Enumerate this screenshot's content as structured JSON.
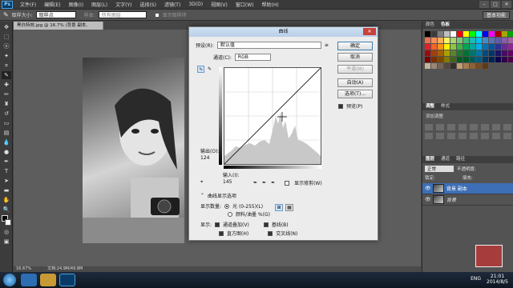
{
  "app": {
    "logo": "Ps"
  },
  "menu": [
    "文件(F)",
    "编辑(E)",
    "图像(I)",
    "图层(L)",
    "文字(Y)",
    "选择(S)",
    "滤镜(T)",
    "3D(D)",
    "视图(V)",
    "窗口(W)",
    "帮助(H)"
  ],
  "window_controls": [
    "–",
    "□",
    "✕"
  ],
  "options": {
    "brush_size_label": "取样大小:",
    "brush_size_value": "取样点",
    "sample_label": "样本:",
    "sample_value": "所有图层",
    "show_ring_label": "显示取样环",
    "workspace": "基本功能"
  },
  "document": {
    "tab_title": "黑白特效.jpg @ 16.7% (背景 副本, RGB/8#) *",
    "zoom": "16.67%",
    "doc_size": "文档:24.9M/49.8M"
  },
  "tools": [
    "move",
    "marquee",
    "lasso",
    "quick-select",
    "crop",
    "eyedropper",
    "heal",
    "brush",
    "stamp",
    "history",
    "eraser",
    "gradient",
    "blur",
    "dodge",
    "pen",
    "type",
    "path-select",
    "shape",
    "hand",
    "zoom",
    "fg-bg",
    "mask",
    "screen"
  ],
  "dialog": {
    "title": "曲线",
    "close": "✕",
    "preset_label": "预设(R):",
    "preset_value": "默认值",
    "channel_label": "通道(C):",
    "channel_value": "RGB",
    "output_label": "输出(O):",
    "output_value": "124",
    "input_label": "输入(I):",
    "input_value": "145",
    "show_clipping": "显示修剪(W)",
    "curve_display_options": "曲线显示选项",
    "show_amount_label": "显示数量:",
    "light_option": "光 (0-255)(L)",
    "pigment_option": "颜料/油墨 %(G)",
    "show_label": "显示:",
    "channel_overlay": "通道叠加(V)",
    "baseline": "基线(B)",
    "histogram": "直方图(H)",
    "intersection_line": "交叉线(N)",
    "buttons": {
      "ok": "确定",
      "cancel": "取消",
      "smooth": "平滑(M)",
      "auto": "自动(A)",
      "options": "选项(T)...",
      "preview": "预览(P)"
    }
  },
  "panels": {
    "color_tabs": [
      "颜色",
      "色板"
    ],
    "adjust_tabs": [
      "调整",
      "样式"
    ],
    "adjust_add": "添加调整",
    "layer_tabs": [
      "图层",
      "通道",
      "路径"
    ],
    "blend_mode": "正常",
    "opacity": "不透明度:",
    "lock": "锁定:",
    "fill": "填充:",
    "layers": [
      {
        "name": "背景 副本",
        "selected": true
      },
      {
        "name": "背景",
        "selected": false
      }
    ]
  },
  "swatches": [
    "#000000",
    "#3b3b3b",
    "#7d7d7d",
    "#bfbfbf",
    "#ffffff",
    "#ff0000",
    "#ffff00",
    "#00ff00",
    "#00ffff",
    "#0000ff",
    "#ff00ff",
    "#a50000",
    "#a5a500",
    "#00a500",
    "#f26c4f",
    "#f68e55",
    "#fbaf5c",
    "#fff467",
    "#acd372",
    "#7cc576",
    "#3bb878",
    "#1abbb4",
    "#00bff3",
    "#438ccb",
    "#5574b9",
    "#605ca8",
    "#855fa8",
    "#a763a8",
    "#ed1c24",
    "#f26522",
    "#f7941d",
    "#fff200",
    "#8dc73f",
    "#39b54a",
    "#00a651",
    "#00a99d",
    "#00aeef",
    "#0072bc",
    "#0054a6",
    "#2e3192",
    "#662d91",
    "#92278f",
    "#9e0b0f",
    "#a0410d",
    "#a36209",
    "#aba000",
    "#598527",
    "#1a7b30",
    "#007236",
    "#00746b",
    "#0076a3",
    "#004b80",
    "#003471",
    "#1b1464",
    "#440e62",
    "#630460",
    "#790000",
    "#7b2e00",
    "#7d4900",
    "#827b00",
    "#406618",
    "#005e20",
    "#005826",
    "#005952",
    "#005b7f",
    "#003663",
    "#002157",
    "#0d004c",
    "#32004b",
    "#4b0049",
    "#c7b299",
    "#998675",
    "#736357",
    "#534741",
    "#37302a",
    "#c69c6d",
    "#a67c52",
    "#8c6239",
    "#754c24",
    "#603913"
  ],
  "taskbar": {
    "tray_lang": "ENG",
    "time": "21:01",
    "date": "2014/8/5"
  }
}
